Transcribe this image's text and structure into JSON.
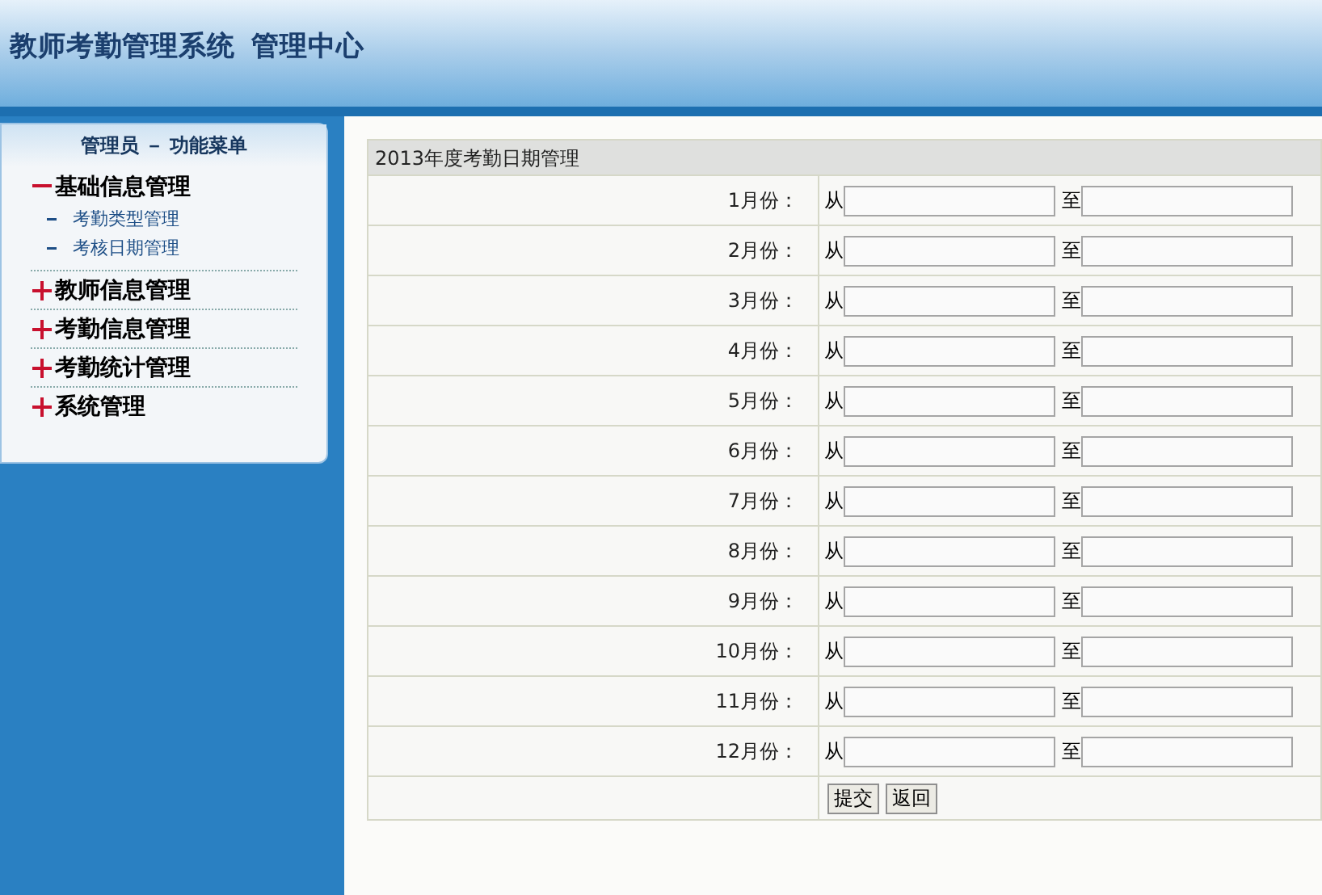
{
  "header": {
    "title": "教师考勤管理系统  管理中心"
  },
  "sidebar": {
    "title": "管理员 － 功能菜单",
    "groups": [
      {
        "label": "基础信息管理",
        "expanded": true,
        "children": [
          {
            "label": "考勤类型管理"
          },
          {
            "label": "考核日期管理"
          }
        ]
      },
      {
        "label": "教师信息管理",
        "expanded": false
      },
      {
        "label": "考勤信息管理",
        "expanded": false
      },
      {
        "label": "考勤统计管理",
        "expanded": false
      },
      {
        "label": "系统管理",
        "expanded": false
      }
    ]
  },
  "form": {
    "title": "2013年度考勤日期管理",
    "rows": [
      {
        "label": "1月份：",
        "from_label": "从",
        "to_label": "至"
      },
      {
        "label": "2月份：",
        "from_label": "从",
        "to_label": "至"
      },
      {
        "label": "3月份：",
        "from_label": "从",
        "to_label": "至"
      },
      {
        "label": "4月份：",
        "from_label": "从",
        "to_label": "至"
      },
      {
        "label": "5月份：",
        "from_label": "从",
        "to_label": "至"
      },
      {
        "label": "6月份：",
        "from_label": "从",
        "to_label": "至"
      },
      {
        "label": "7月份：",
        "from_label": "从",
        "to_label": "至"
      },
      {
        "label": "8月份：",
        "from_label": "从",
        "to_label": "至"
      },
      {
        "label": "9月份：",
        "from_label": "从",
        "to_label": "至"
      },
      {
        "label": "10月份：",
        "from_label": "从",
        "to_label": "至"
      },
      {
        "label": "11月份：",
        "from_label": "从",
        "to_label": "至"
      },
      {
        "label": "12月份：",
        "from_label": "从",
        "to_label": "至"
      }
    ],
    "buttons": [
      "提交",
      "返回"
    ]
  }
}
